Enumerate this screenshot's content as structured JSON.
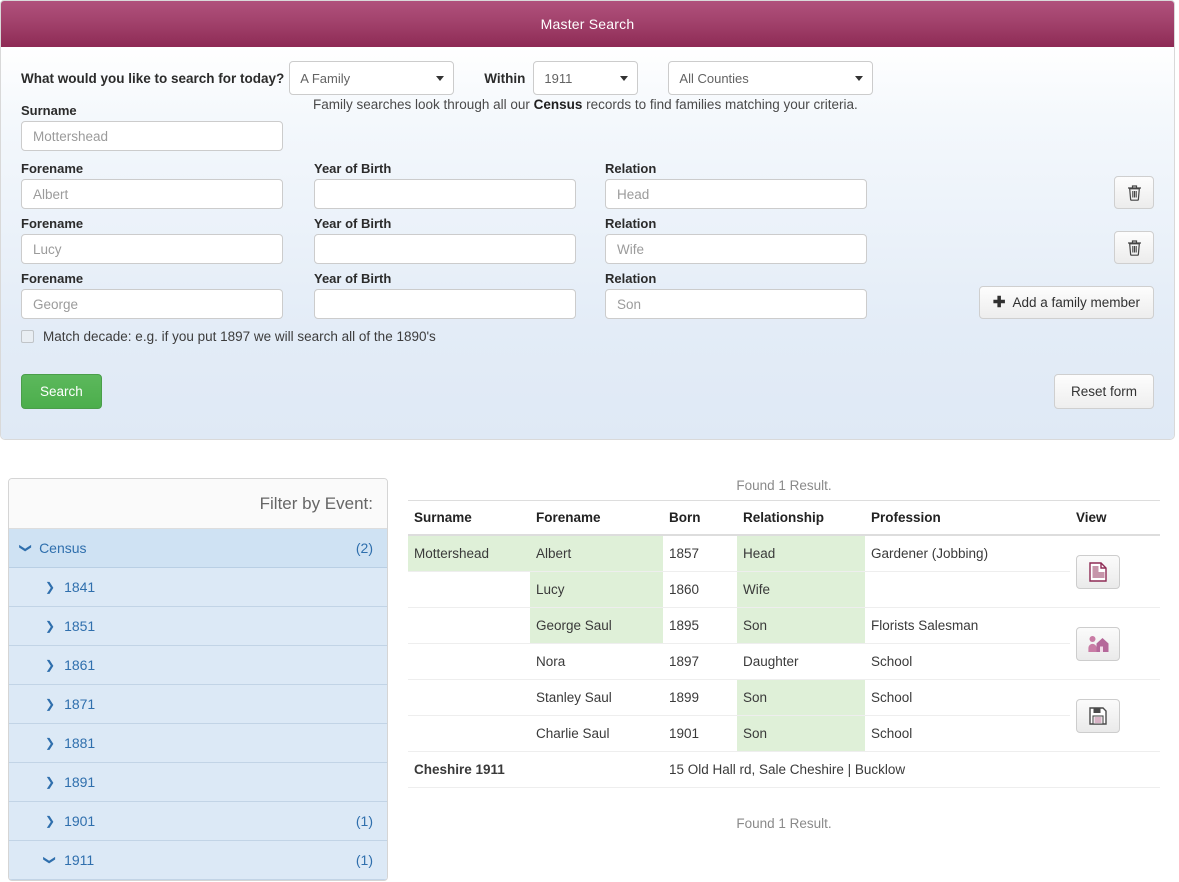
{
  "panel": {
    "title": "Master Search"
  },
  "search_form": {
    "prompt_label": "What would you like to search for today?",
    "type_select": {
      "value": "A Family",
      "options": [
        "A Family"
      ]
    },
    "within_label": "Within",
    "year_select": {
      "value": "1911",
      "options": [
        "1911"
      ]
    },
    "county_select": {
      "value": "All Counties",
      "options": [
        "All Counties"
      ]
    },
    "surname_label": "Surname",
    "surname_value": "Mottershead",
    "blurb_prefix": "Family searches look through all our ",
    "blurb_bold": "Census",
    "blurb_suffix": " records to find families matching your criteria.",
    "forename_label": "Forename",
    "year_of_birth_label": "Year of Birth",
    "relation_label": "Relation",
    "members": [
      {
        "forename": "Albert",
        "year_of_birth": "",
        "relation": "Head",
        "action": "delete"
      },
      {
        "forename": "Lucy",
        "year_of_birth": "",
        "relation": "Wife",
        "action": "delete"
      },
      {
        "forename": "George",
        "year_of_birth": "",
        "relation": "Son",
        "action": "add"
      }
    ],
    "delete_icon": "trash-icon",
    "add_member_label": "Add a family member",
    "add_member_icon": "plus-icon",
    "match_decade_label": "Match decade: e.g. if you put 1897 we will search all of the 1890's",
    "match_decade_checked": false,
    "search_label": "Search",
    "reset_label": "Reset form",
    "search_color": "#5cb85c",
    "header_color": "#a2426c"
  },
  "sidebar": {
    "title": "Filter by Event:",
    "groups": [
      {
        "label": "Census",
        "count": "(2)",
        "expanded": true,
        "chevron": "chevron-down-icon",
        "years": [
          {
            "label": "1841",
            "count": "",
            "chevron": "chevron-right-icon",
            "expanded": false
          },
          {
            "label": "1851",
            "count": "",
            "chevron": "chevron-right-icon",
            "expanded": false
          },
          {
            "label": "1861",
            "count": "",
            "chevron": "chevron-right-icon",
            "expanded": false
          },
          {
            "label": "1871",
            "count": "",
            "chevron": "chevron-right-icon",
            "expanded": false
          },
          {
            "label": "1881",
            "count": "",
            "chevron": "chevron-right-icon",
            "expanded": false
          },
          {
            "label": "1891",
            "count": "",
            "chevron": "chevron-right-icon",
            "expanded": false
          },
          {
            "label": "1901",
            "count": "(1)",
            "chevron": "chevron-right-icon",
            "expanded": false
          },
          {
            "label": "1911",
            "count": "(1)",
            "chevron": "chevron-down-icon",
            "expanded": true
          }
        ]
      }
    ]
  },
  "results": {
    "found_top": "Found 1 Result.",
    "found_bottom": "Found 1 Result.",
    "columns": [
      "Surname",
      "Forename",
      "Born",
      "Relationship",
      "Profession",
      "View"
    ],
    "rows": [
      {
        "surname": "Mottershead",
        "forename": "Albert",
        "born": "1857",
        "relationship": "Head",
        "profession": "Gardener (Jobbing)",
        "surname_hl": true,
        "forename_hl": true,
        "relationship_hl": true
      },
      {
        "surname": "",
        "forename": "Lucy",
        "born": "1860",
        "relationship": "Wife",
        "profession": "",
        "surname_hl": false,
        "forename_hl": true,
        "relationship_hl": true
      },
      {
        "surname": "",
        "forename": "George Saul",
        "born": "1895",
        "relationship": "Son",
        "profession": "Florists Salesman",
        "surname_hl": false,
        "forename_hl": true,
        "relationship_hl": true
      },
      {
        "surname": "",
        "forename": "Nora",
        "born": "1897",
        "relationship": "Daughter",
        "profession": "School",
        "surname_hl": false,
        "forename_hl": false,
        "relationship_hl": false
      },
      {
        "surname": "",
        "forename": "Stanley Saul",
        "born": "1899",
        "relationship": "Son",
        "profession": "School",
        "surname_hl": false,
        "forename_hl": false,
        "relationship_hl": true
      },
      {
        "surname": "",
        "forename": "Charlie Saul",
        "born": "1901",
        "relationship": "Son",
        "profession": "School",
        "surname_hl": false,
        "forename_hl": false,
        "relationship_hl": true
      }
    ],
    "view_buttons": [
      {
        "icon": "transcript-document-icon",
        "color": "#8e2b55"
      },
      {
        "icon": "household-person-house-icon",
        "color": "#c97ca5"
      },
      {
        "icon": "save-floppy-disk-icon",
        "color": "#4a4a4a"
      }
    ],
    "address_place": "Cheshire 1911",
    "address_text": "15 Old Hall rd, Sale Cheshire | Bucklow"
  }
}
